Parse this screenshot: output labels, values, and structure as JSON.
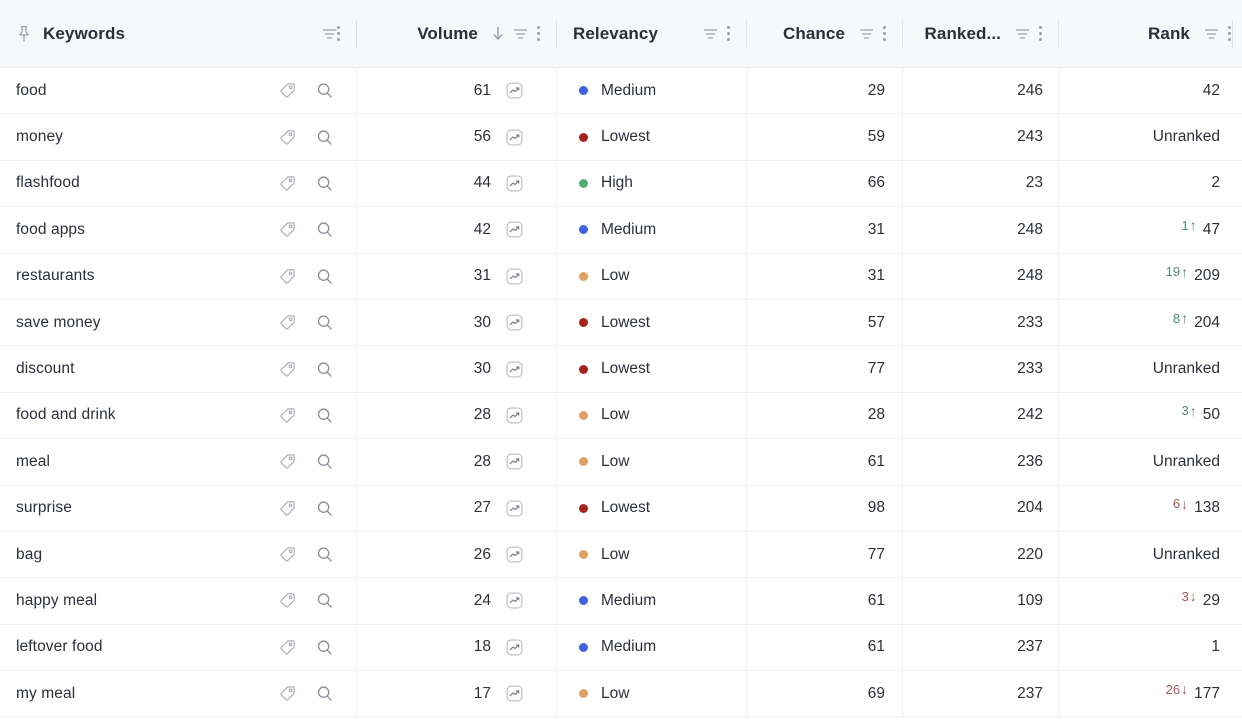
{
  "table": {
    "columns": [
      {
        "key": "keywords",
        "label": "Keywords",
        "pinned": true,
        "filterable": true,
        "menu": true,
        "sorted": null
      },
      {
        "key": "volume",
        "label": "Volume",
        "pinned": false,
        "filterable": true,
        "menu": true,
        "sorted": "desc"
      },
      {
        "key": "relevancy",
        "label": "Relevancy",
        "pinned": false,
        "filterable": true,
        "menu": true,
        "sorted": null
      },
      {
        "key": "chance",
        "label": "Chance",
        "pinned": false,
        "filterable": true,
        "menu": true,
        "sorted": null
      },
      {
        "key": "ranked",
        "label": "Ranked...",
        "pinned": false,
        "filterable": true,
        "menu": true,
        "sorted": null
      },
      {
        "key": "rank",
        "label": "Rank",
        "pinned": false,
        "filterable": true,
        "menu": true,
        "sorted": null
      }
    ],
    "icons": {
      "pin": "pushpin-icon",
      "filter": "filter-funnel-icon",
      "menu": "kebab-menu-icon",
      "sort_desc": "sort-descending-arrow-icon",
      "row_tag": "tag-icon",
      "row_search": "search-icon",
      "row_trend": "trend-chart-icon"
    },
    "relevancy_colors": {
      "High": "#52b072",
      "Medium": "#3f62e0",
      "Low": "#e0a063",
      "Lowest": "#a5251c"
    },
    "delta_colors": {
      "up": "#4e8a72",
      "down": "#a5584e"
    },
    "unranked_label": "Unranked",
    "rows": [
      {
        "keyword": "food",
        "volume": "61",
        "relevancy": "Medium",
        "chance": "29",
        "ranked": "246",
        "rank": "42",
        "delta": null,
        "delta_dir": null
      },
      {
        "keyword": "money",
        "volume": "56",
        "relevancy": "Lowest",
        "chance": "59",
        "ranked": "243",
        "rank": "Unranked",
        "delta": null,
        "delta_dir": null
      },
      {
        "keyword": "flashfood",
        "volume": "44",
        "relevancy": "High",
        "chance": "66",
        "ranked": "23",
        "rank": "2",
        "delta": null,
        "delta_dir": null
      },
      {
        "keyword": "food apps",
        "volume": "42",
        "relevancy": "Medium",
        "chance": "31",
        "ranked": "248",
        "rank": "47",
        "delta": "1",
        "delta_dir": "up"
      },
      {
        "keyword": "restaurants",
        "volume": "31",
        "relevancy": "Low",
        "chance": "31",
        "ranked": "248",
        "rank": "209",
        "delta": "19",
        "delta_dir": "up"
      },
      {
        "keyword": "save money",
        "volume": "30",
        "relevancy": "Lowest",
        "chance": "57",
        "ranked": "233",
        "rank": "204",
        "delta": "8",
        "delta_dir": "up"
      },
      {
        "keyword": "discount",
        "volume": "30",
        "relevancy": "Lowest",
        "chance": "77",
        "ranked": "233",
        "rank": "Unranked",
        "delta": null,
        "delta_dir": null
      },
      {
        "keyword": "food and drink",
        "volume": "28",
        "relevancy": "Low",
        "chance": "28",
        "ranked": "242",
        "rank": "50",
        "delta": "3",
        "delta_dir": "up"
      },
      {
        "keyword": "meal",
        "volume": "28",
        "relevancy": "Low",
        "chance": "61",
        "ranked": "236",
        "rank": "Unranked",
        "delta": null,
        "delta_dir": null
      },
      {
        "keyword": "surprise",
        "volume": "27",
        "relevancy": "Lowest",
        "chance": "98",
        "ranked": "204",
        "rank": "138",
        "delta": "6",
        "delta_dir": "down"
      },
      {
        "keyword": "bag",
        "volume": "26",
        "relevancy": "Low",
        "chance": "77",
        "ranked": "220",
        "rank": "Unranked",
        "delta": null,
        "delta_dir": null
      },
      {
        "keyword": "happy meal",
        "volume": "24",
        "relevancy": "Medium",
        "chance": "61",
        "ranked": "109",
        "rank": "29",
        "delta": "3",
        "delta_dir": "down"
      },
      {
        "keyword": "leftover food",
        "volume": "18",
        "relevancy": "Medium",
        "chance": "61",
        "ranked": "237",
        "rank": "1",
        "delta": null,
        "delta_dir": null
      },
      {
        "keyword": "my meal",
        "volume": "17",
        "relevancy": "Low",
        "chance": "69",
        "ranked": "237",
        "rank": "177",
        "delta": "26",
        "delta_dir": "down"
      }
    ]
  }
}
